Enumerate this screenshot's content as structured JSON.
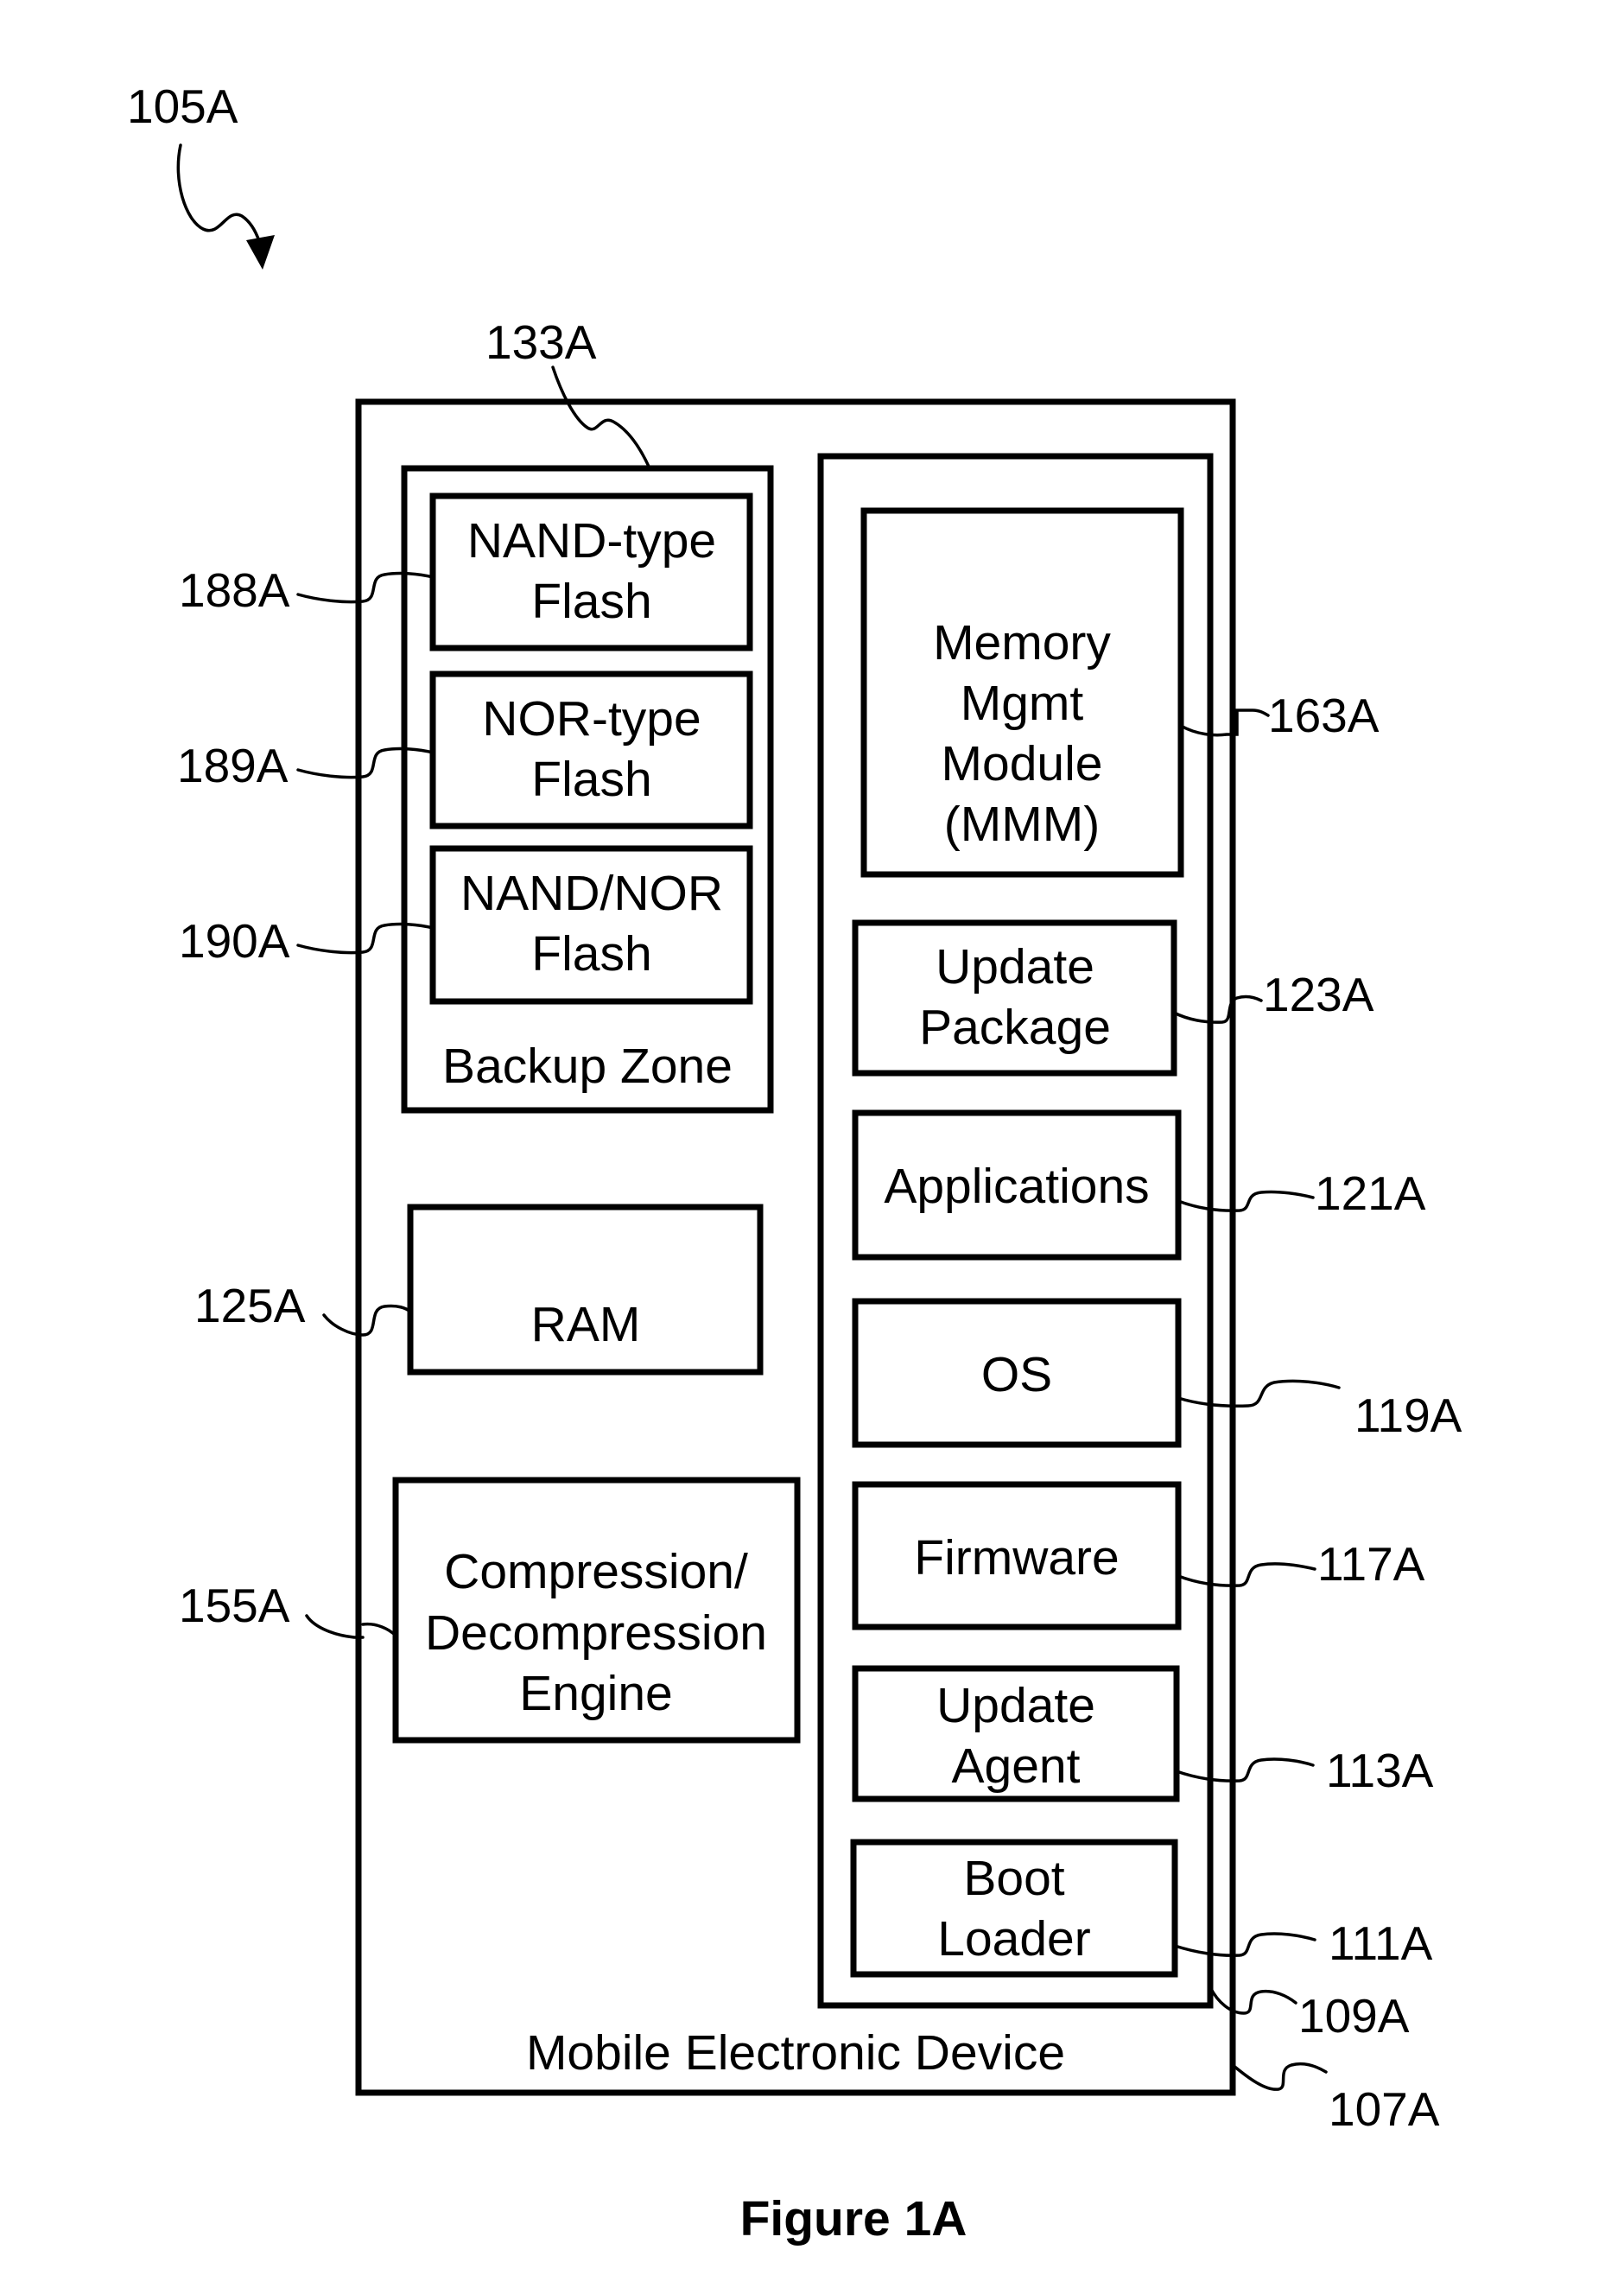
{
  "figure": {
    "caption": "Figure 1A",
    "reference": "105A"
  },
  "device": {
    "label": "Mobile Electronic Device",
    "ref": "107A"
  },
  "backup_zone": {
    "label": "Backup Zone",
    "ref": "133A",
    "items": [
      {
        "lines": [
          "NAND-type",
          "Flash"
        ],
        "ref": "188A"
      },
      {
        "lines": [
          "NOR-type",
          "Flash"
        ],
        "ref": "189A"
      },
      {
        "lines": [
          "NAND/NOR",
          "Flash"
        ],
        "ref": "190A"
      }
    ]
  },
  "ram": {
    "label": "RAM",
    "ref": "125A"
  },
  "engine": {
    "lines": [
      "Compression/",
      "Decompression",
      "Engine"
    ],
    "ref": "155A"
  },
  "memory_column": {
    "ref": "109A",
    "items": [
      {
        "lines": [
          "Memory",
          "Mgmt",
          "Module",
          "(MMM)"
        ],
        "ref": "163A"
      },
      {
        "lines": [
          "Update",
          "Package"
        ],
        "ref": "123A"
      },
      {
        "lines": [
          "Applications"
        ],
        "ref": "121A"
      },
      {
        "lines": [
          "OS"
        ],
        "ref": "119A"
      },
      {
        "lines": [
          "Firmware"
        ],
        "ref": "117A"
      },
      {
        "lines": [
          "Update",
          "Agent"
        ],
        "ref": "113A"
      },
      {
        "lines": [
          "Boot",
          "Loader"
        ],
        "ref": "111A"
      }
    ]
  }
}
